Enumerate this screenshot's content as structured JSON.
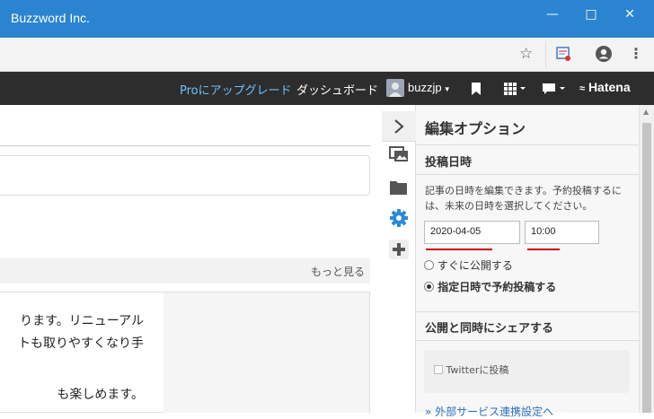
{
  "window": {
    "title": "Buzzword Inc."
  },
  "nav": {
    "upgrade": "Proにアップグレード",
    "dashboard": "ダッシュボード",
    "user": "buzzjp",
    "brand": "Hatena"
  },
  "left": {
    "more": "もっと見る",
    "lines": [
      "ります。リニューアル",
      "トも取りやすくなり手",
      "も楽しめます。"
    ]
  },
  "panel": {
    "title": "編集オプション",
    "section_datetime": "投稿日時",
    "desc": "記事の日時を編集できます。予約投稿するには、未来の日時を選択してください。",
    "date": "2020-04-05",
    "time": "10:00",
    "radio_now": "すぐに公開する",
    "radio_scheduled": "指定日時で予約投稿する",
    "section_share": "公開と同時にシェアする",
    "twitter": "Twitterに投稿",
    "external": "» 外部サービス連携設定へ"
  },
  "colors": {
    "titlebar": "#2b84d0",
    "navbar": "#2d2d2d",
    "upgrade": "#6fc1ff",
    "underline": "#cc0000",
    "gear": "#2a8ad4"
  }
}
